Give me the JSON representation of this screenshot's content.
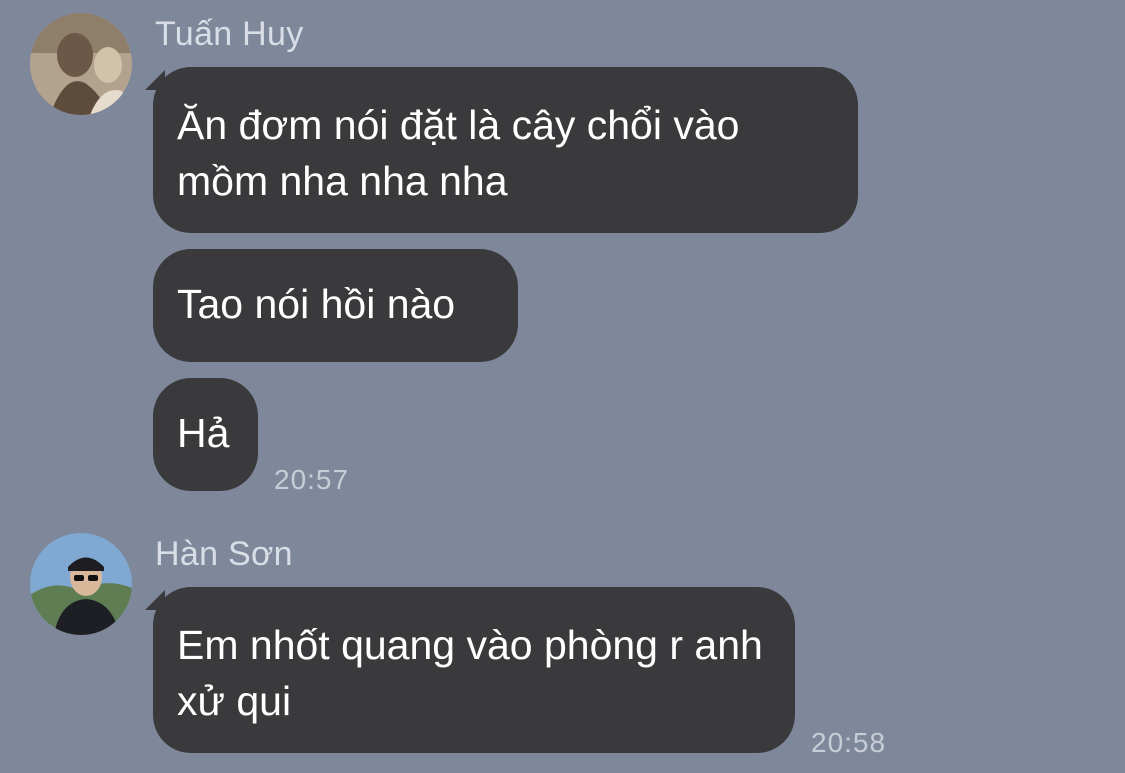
{
  "chat": {
    "groups": [
      {
        "sender": "Tuấn Huy",
        "avatar_icon": "sender-avatar-photo",
        "messages": [
          {
            "text": "Ăn đơm nói đặt là cây chổi vào mồm nha nha nha"
          },
          {
            "text": "Tao nói hồi nào"
          },
          {
            "text": "Hả"
          }
        ],
        "time": "20:57"
      },
      {
        "sender": "Hàn Sơn",
        "avatar_icon": "sender-avatar-photo",
        "messages": [
          {
            "text": "Em nhốt quang vào phòng r anh xử qui"
          }
        ],
        "time": "20:58"
      }
    ]
  }
}
